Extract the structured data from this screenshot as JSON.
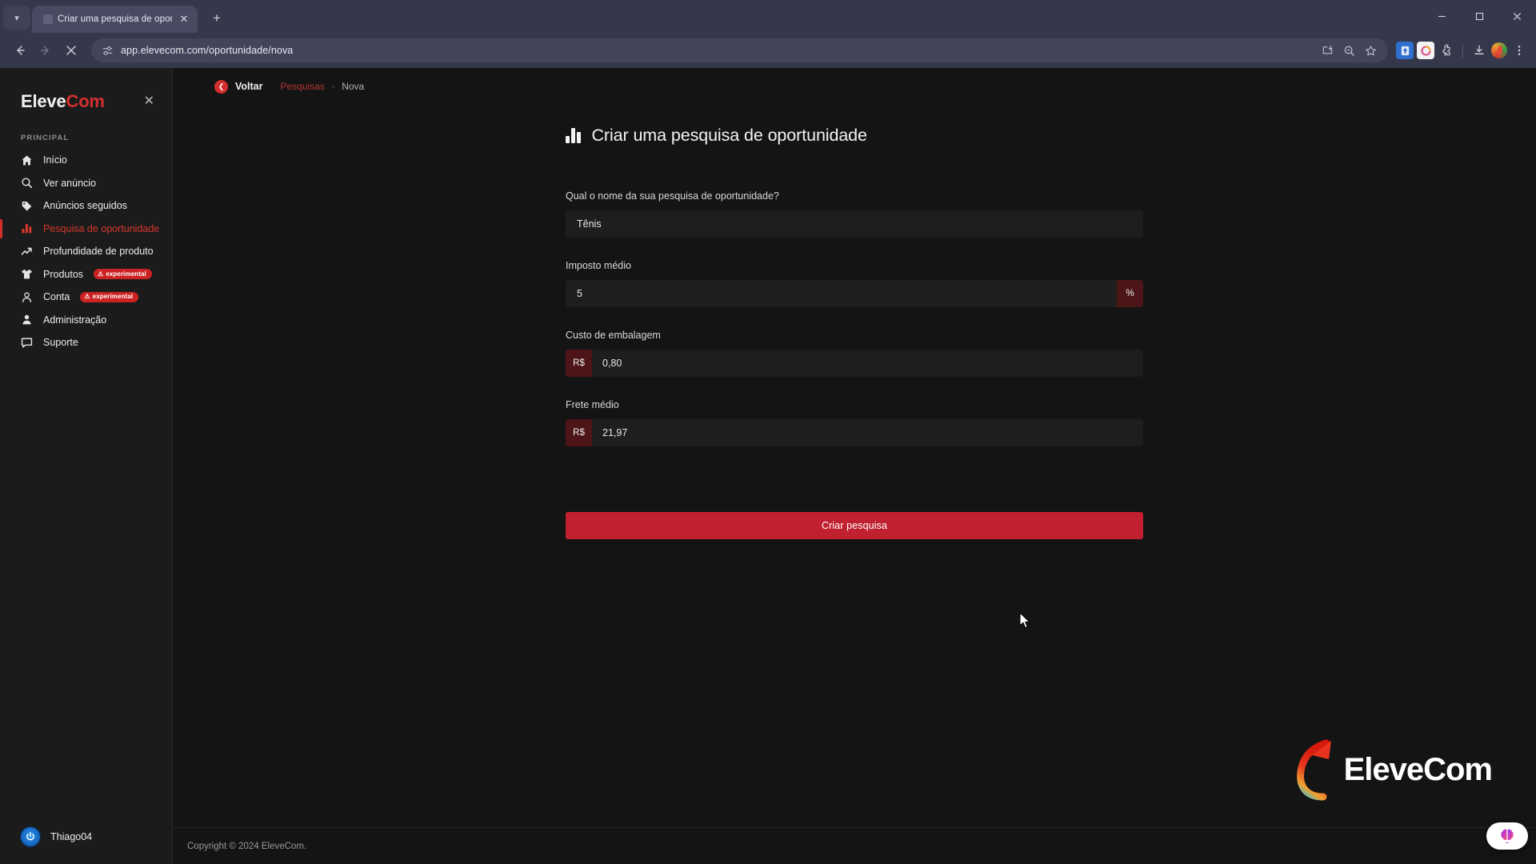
{
  "browser": {
    "tab": {
      "title": "Criar uma pesquisa de oportun",
      "close_icon": "close-icon",
      "dropdown_icon": "chevron-down-icon"
    },
    "new_tab_label": "+",
    "window_controls": {
      "minimize": "–",
      "maximize": "◻",
      "close": "✕"
    },
    "nav": {
      "back": "←",
      "forward": "→",
      "stop": "✕"
    },
    "omnibox": {
      "url": "app.elevecom.com/oportunidade/nova",
      "site_info_icon": "page-settings-icon",
      "install_icon": "install-app-icon",
      "zoom_icon": "zoom-out-icon",
      "bookmark_icon": "star-icon"
    },
    "toolbar_right": {
      "extension1": "password-manager-icon",
      "extension2": "extension-app-icon",
      "extensions": "puzzle-icon",
      "downloads": "download-icon",
      "profile": "profile-avatar",
      "menu": "kebab-menu-icon"
    }
  },
  "sidebar": {
    "brand": {
      "part1": "Eleve",
      "part2": "Com"
    },
    "close_label": "✕",
    "section_label": "PRINCIPAL",
    "items": [
      {
        "label": "Início",
        "icon": "home-icon",
        "active": false
      },
      {
        "label": "Ver anúncio",
        "icon": "search-icon",
        "active": false
      },
      {
        "label": "Anúncios seguidos",
        "icon": "tag-icon",
        "active": false
      },
      {
        "label": "Pesquisa de oportunidade",
        "icon": "bar-chart-icon",
        "active": true
      },
      {
        "label": "Profundidade de produto",
        "icon": "trending-up-icon",
        "active": false
      },
      {
        "label": "Produtos",
        "icon": "shirt-icon",
        "active": false,
        "badge": "experimental"
      },
      {
        "label": "Conta",
        "icon": "user-outline-icon",
        "active": false,
        "badge": "experimental"
      },
      {
        "label": "Administração",
        "icon": "user-filled-icon",
        "active": false
      },
      {
        "label": "Suporte",
        "icon": "chat-icon",
        "active": false
      }
    ],
    "badge_text": "experimental",
    "user": {
      "name": "Thiago04",
      "avatar_icon": "power-avatar-icon"
    }
  },
  "breadcrumb": {
    "back_label": "Voltar",
    "back_icon": "chevron-left-icon",
    "link": "Pesquisas",
    "separator": "›",
    "current": "Nova"
  },
  "page": {
    "title": "Criar uma pesquisa de oportunidade",
    "title_icon": "bar-chart-icon"
  },
  "form": {
    "fields": [
      {
        "label": "Qual o nome da sua pesquisa de oportunidade?",
        "value": "Tênis",
        "placeholder": "",
        "prefix": "",
        "suffix": "",
        "name": "research-name-input"
      },
      {
        "label": "Imposto médio",
        "value": "5",
        "placeholder": "",
        "prefix": "",
        "suffix": "%",
        "name": "average-tax-input"
      },
      {
        "label": "Custo de embalagem",
        "value": "0,80",
        "placeholder": "",
        "prefix": "R$",
        "suffix": "",
        "name": "packaging-cost-input"
      },
      {
        "label": "Frete médio",
        "value": "21,97",
        "placeholder": "",
        "prefix": "R$",
        "suffix": "",
        "name": "average-shipping-input"
      }
    ],
    "submit_label": "Criar pesquisa"
  },
  "watermark": {
    "text": "EleveCom",
    "icon": "arrow-up-logo-icon"
  },
  "footer": {
    "copyright": "Copyright © 2024 EleveCom."
  },
  "fab": {
    "icon": "brain-icon"
  },
  "colors": {
    "accent_red": "#d32f2f",
    "submit_red": "#c0202f",
    "badge_red": "#cc2222",
    "prefix_red": "#4d1517",
    "page_bg": "#141414",
    "sidebar_bg": "#1b1b1b",
    "input_bg": "#1e1e1e",
    "chrome_bg": "#35374a"
  }
}
